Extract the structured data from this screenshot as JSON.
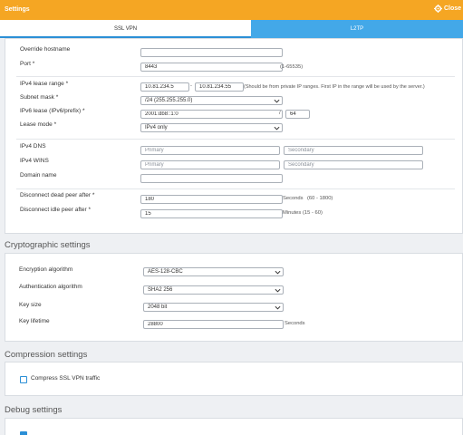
{
  "window": {
    "title": "Settings",
    "close_label": "Close"
  },
  "tabs": [
    {
      "label": "SSL VPN",
      "active": true
    },
    {
      "label": "L2TP",
      "active": false
    }
  ],
  "general": {
    "override_hostname": {
      "label": "Override hostname",
      "value": ""
    },
    "port": {
      "label": "Port *",
      "value": "8443",
      "hint": "(1-65535)"
    },
    "ipv4_lease_range": {
      "label": "IPv4 lease range *",
      "start": "10.81.234.5",
      "dash": "-",
      "end": "10.81.234.55",
      "hint": "(Should be from private IP ranges. First IP in the range will be used by the server.)"
    },
    "subnet_mask": {
      "label": "Subnet mask *",
      "value": "/24 (255.255.255.0)"
    },
    "ipv6_lease": {
      "label": "IPv6 lease (IPv6/prefix) *",
      "value": "2001:db8::1:0",
      "slash": "/",
      "prefix": "64"
    },
    "lease_mode": {
      "label": "Lease mode *",
      "value": "IPv4 only"
    },
    "ipv4_dns": {
      "label": "IPv4 DNS",
      "primary_placeholder": "Primary",
      "secondary_placeholder": "Secondary"
    },
    "ipv4_wins": {
      "label": "IPv4 WINS",
      "primary_placeholder": "Primary",
      "secondary_placeholder": "Secondary"
    },
    "domain_name": {
      "label": "Domain name",
      "value": ""
    },
    "disconnect_dead_peer": {
      "label": "Disconnect dead peer after *",
      "value": "180",
      "unit": "Seconds",
      "range": "(60 - 1800)"
    },
    "disconnect_idle_peer": {
      "label": "Disconnect idle peer after *",
      "value": "15",
      "unit": "Minutes",
      "range": "(15 - 60)"
    }
  },
  "crypto": {
    "title": "Cryptographic settings",
    "encryption": {
      "label": "Encryption algorithm",
      "value": "AES-128-CBC"
    },
    "authentication": {
      "label": "Authentication algorithm",
      "value": "SHA2 256"
    },
    "key_size": {
      "label": "Key size",
      "value": "2048 bit"
    },
    "key_lifetime": {
      "label": "Key lifetime",
      "value": "28800",
      "unit": "Seconds"
    }
  },
  "compression": {
    "title": "Compression settings",
    "compress_label": "Compress SSL VPN traffic",
    "compress_checked": false
  },
  "debug": {
    "title": "Debug settings",
    "enable_checked": true
  },
  "colors": {
    "accent": "#f5a623",
    "tab_blue": "#43a8e8",
    "checkbox_blue": "#2b8fd6"
  }
}
